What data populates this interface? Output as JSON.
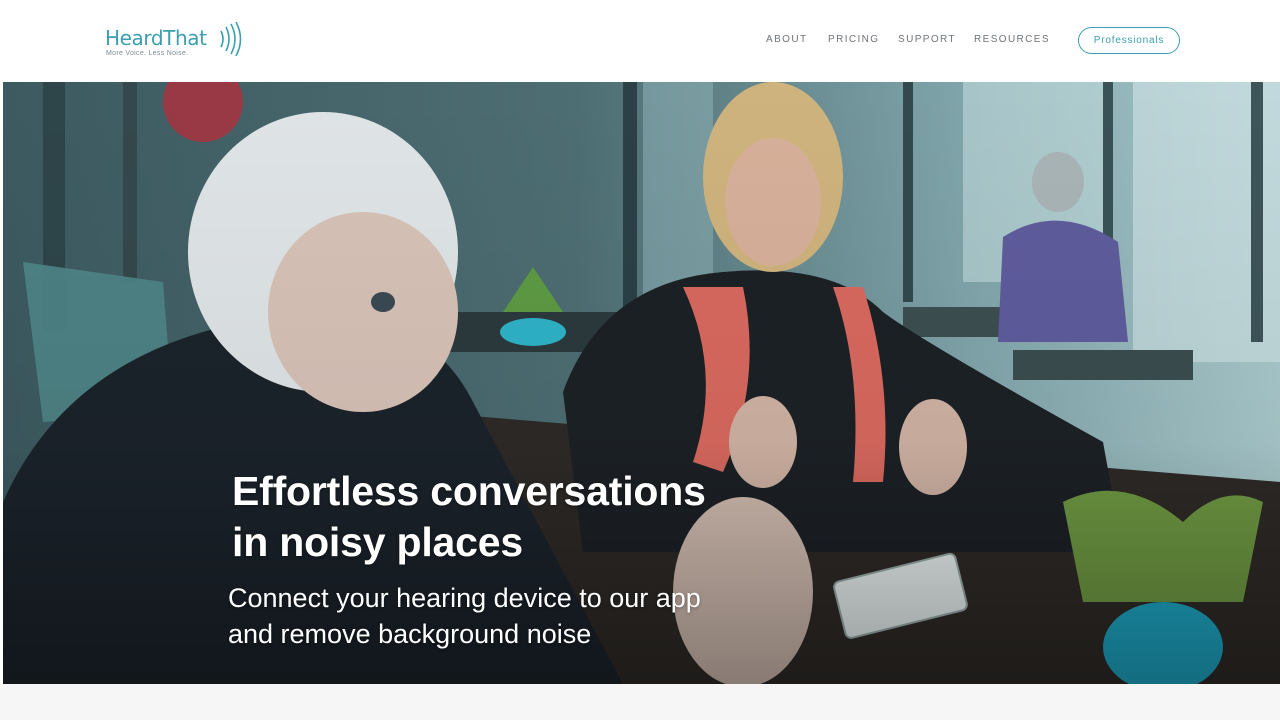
{
  "brand": {
    "name": "HeardThat",
    "tagline": "More Voice. Less Noise.",
    "accent_color": "#3a9fb0"
  },
  "nav": {
    "items": [
      {
        "label": "ABOUT"
      },
      {
        "label": "PRICING"
      },
      {
        "label": "SUPPORT"
      },
      {
        "label": "RESOURCES"
      }
    ],
    "cta_label": "Professionals"
  },
  "hero": {
    "title_line1": "Effortless conversations",
    "title_line2": "in noisy places",
    "subtitle_line1": "Connect your hearing device to our app",
    "subtitle_line2": "and remove background noise",
    "image_icon": "cafe-conversation-photo"
  },
  "icons": {
    "logo_waves": "sound-waves-icon"
  }
}
